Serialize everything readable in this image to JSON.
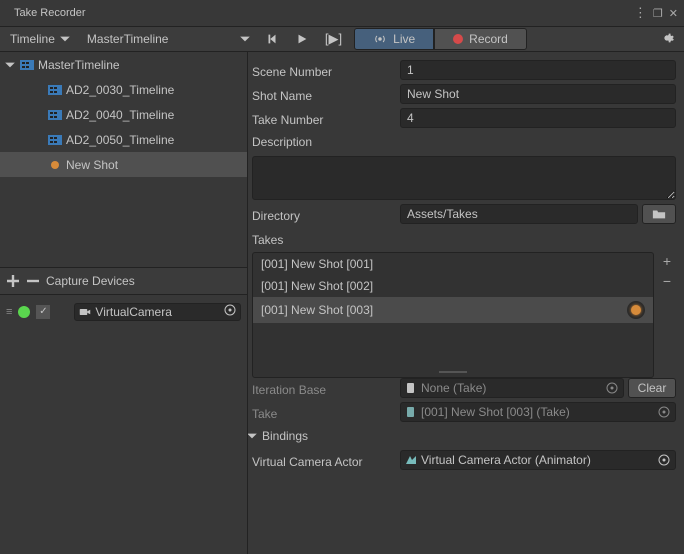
{
  "window": {
    "title": "Take Recorder"
  },
  "toolbar": {
    "contextLabel": "Timeline",
    "timeline": "MasterTimeline",
    "live": "Live",
    "record": "Record",
    "activeMode": "live"
  },
  "tree": {
    "items": [
      {
        "label": "MasterTimeline",
        "level": 0,
        "expanded": true,
        "selected": false,
        "icon": "timeline"
      },
      {
        "label": "AD2_0030_Timeline",
        "level": 1,
        "expanded": false,
        "selected": false,
        "icon": "timeline"
      },
      {
        "label": "AD2_0040_Timeline",
        "level": 1,
        "expanded": false,
        "selected": false,
        "icon": "timeline"
      },
      {
        "label": "AD2_0050_Timeline",
        "level": 1,
        "expanded": false,
        "selected": false,
        "icon": "timeline"
      },
      {
        "label": "New Shot",
        "level": 1,
        "expanded": false,
        "selected": true,
        "icon": "shot"
      }
    ]
  },
  "captureHeader": "Capture Devices",
  "device": {
    "enabled": true,
    "label": "VirtualCamera"
  },
  "fields": {
    "sceneNumber": {
      "label": "Scene Number",
      "value": "1"
    },
    "shotName": {
      "label": "Shot Name",
      "value": "New Shot"
    },
    "takeNumber": {
      "label": "Take Number",
      "value": "4"
    },
    "description": {
      "label": "Description",
      "value": ""
    },
    "directory": {
      "label": "Directory",
      "value": "Assets/Takes"
    },
    "takesHeader": "Takes",
    "iterationBase": {
      "label": "Iteration Base",
      "value": "None (Take)"
    },
    "take": {
      "label": "Take",
      "value": "[001] New Shot [003] (Take)"
    },
    "bindings": {
      "header": "Bindings"
    },
    "vcam": {
      "label": "Virtual Camera Actor",
      "value": "Virtual Camera Actor (Animator)"
    },
    "clear": "Clear"
  },
  "takes": [
    {
      "name": "[001] New Shot [001]",
      "selected": false,
      "recording": false
    },
    {
      "name": "[001] New Shot [002]",
      "selected": false,
      "recording": false
    },
    {
      "name": "[001] New Shot [003]",
      "selected": true,
      "recording": true
    }
  ]
}
